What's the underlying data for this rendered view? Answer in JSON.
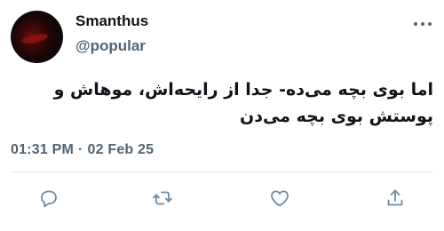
{
  "author": {
    "display_name": "Smanthus",
    "username": "@popular"
  },
  "tweet": {
    "text": "اما بوی بچه می‌ده- جدا از رایحه‌اش، موهاش و پوستش بوی بچه می‌دن"
  },
  "meta": {
    "time": "01:31 PM",
    "separator": "·",
    "date": "02 Feb 25"
  },
  "icons": {
    "reply": "reply-bubble-icon",
    "retweet": "retweet-icon",
    "like": "heart-icon",
    "share": "share-icon",
    "more": "more-options-icon"
  },
  "colors": {
    "text": "#0f1419",
    "secondary": "#536471",
    "icon": "#6e8aa0",
    "divider": "#dfe4e8"
  }
}
